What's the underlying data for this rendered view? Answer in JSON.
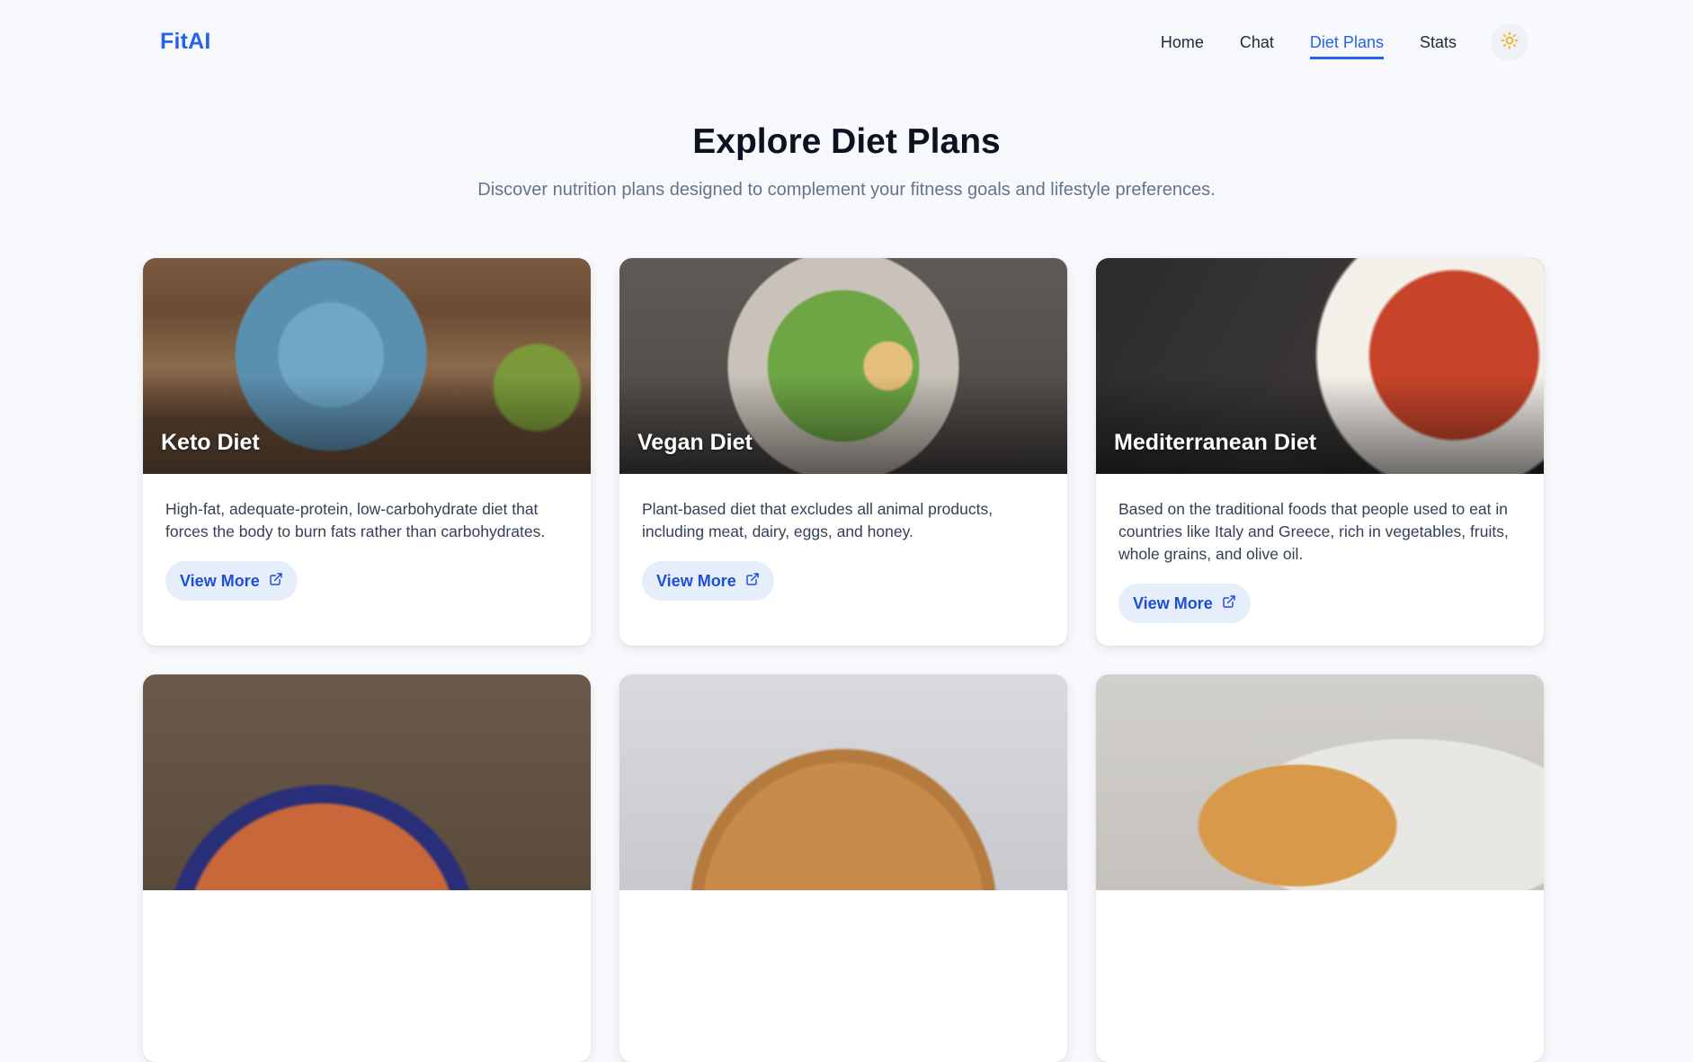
{
  "nav": {
    "logo": "FitAI",
    "links": [
      {
        "label": "Home"
      },
      {
        "label": "Chat"
      },
      {
        "label": "Diet Plans"
      },
      {
        "label": "Stats"
      }
    ],
    "active_link": "Diet Plans",
    "theme_icon": "sun-icon"
  },
  "hero": {
    "title": "Explore Diet Plans",
    "subtitle": "Discover nutrition plans designed to complement your fitness goals and lifestyle preferences."
  },
  "cards": [
    {
      "title": "Keto Diet",
      "description": "High-fat, adequate-protein, low-carbohydrate diet that forces the body to burn fats rather than carbohydrates.",
      "button": "View More"
    },
    {
      "title": "Vegan Diet",
      "description": "Plant-based diet that excludes all animal products, including meat, dairy, eggs, and honey.",
      "button": "View More"
    },
    {
      "title": "Mediterranean Diet",
      "description": "Based on the traditional foods that people used to eat in countries like Italy and Greece, rich in vegetables, fruits, whole grains, and olive oil.",
      "button": "View More"
    }
  ],
  "colors": {
    "accent": "#2563eb",
    "button_bg": "#e6eefc",
    "page_bg": "#f7f9fc"
  }
}
